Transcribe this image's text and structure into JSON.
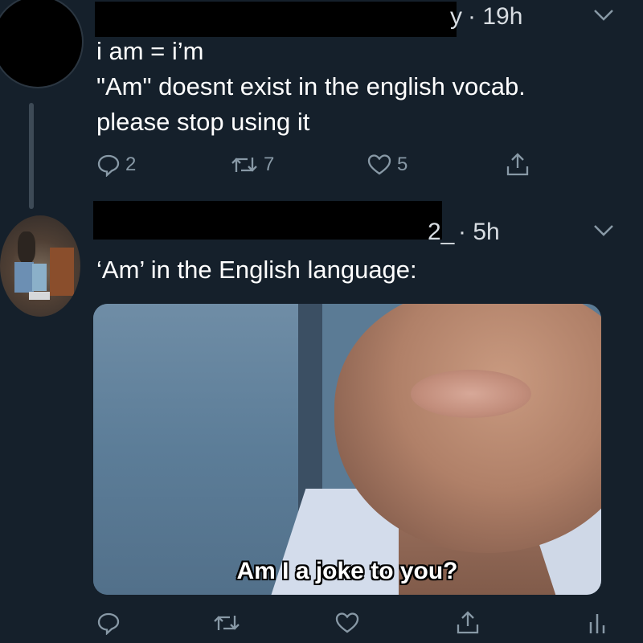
{
  "tweet1": {
    "handle_suffix": "y",
    "time": "· 19h",
    "lines": [
      "i am = i’m",
      "\"Am\" doesnt exist in the english vocab.",
      "please stop using it"
    ],
    "actions": {
      "reply_count": "2",
      "retweet_count": "7",
      "like_count": "5"
    }
  },
  "tweet2": {
    "handle_suffix": "2_",
    "time": "· 5h",
    "text": "‘Am’ in the English language:",
    "media_caption": "Am I a joke to you?"
  },
  "icons": {
    "reply": "reply-icon",
    "retweet": "retweet-icon",
    "like": "heart-icon",
    "share": "share-icon",
    "analytics": "analytics-icon",
    "chevron": "chevron-down-icon"
  },
  "colors": {
    "background": "#15202b",
    "text": "#ffffff",
    "secondary": "#8899a6"
  }
}
